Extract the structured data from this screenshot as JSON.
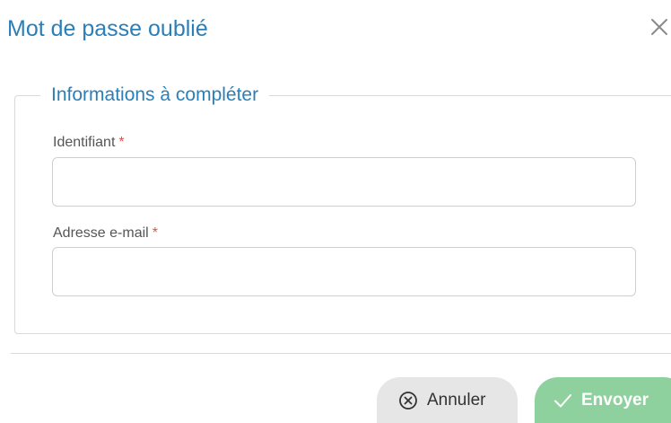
{
  "dialog": {
    "title": "Mot de passe oublié",
    "close_icon": "close-icon"
  },
  "form": {
    "legend": "Informations à compléter",
    "required_marker": "*",
    "fields": [
      {
        "label": "Identifiant",
        "value": "",
        "placeholder": ""
      },
      {
        "label": "Adresse e-mail",
        "value": "",
        "placeholder": ""
      }
    ]
  },
  "actions": {
    "cancel_label": "Annuler",
    "cancel_icon": "circle-x-icon",
    "send_label": "Envoyer",
    "send_icon": "check-icon"
  },
  "colors": {
    "title": "#2a7fb8",
    "required": "#d9534f",
    "send_button": "#8fd19e",
    "cancel_button": "#e6e6e6"
  }
}
